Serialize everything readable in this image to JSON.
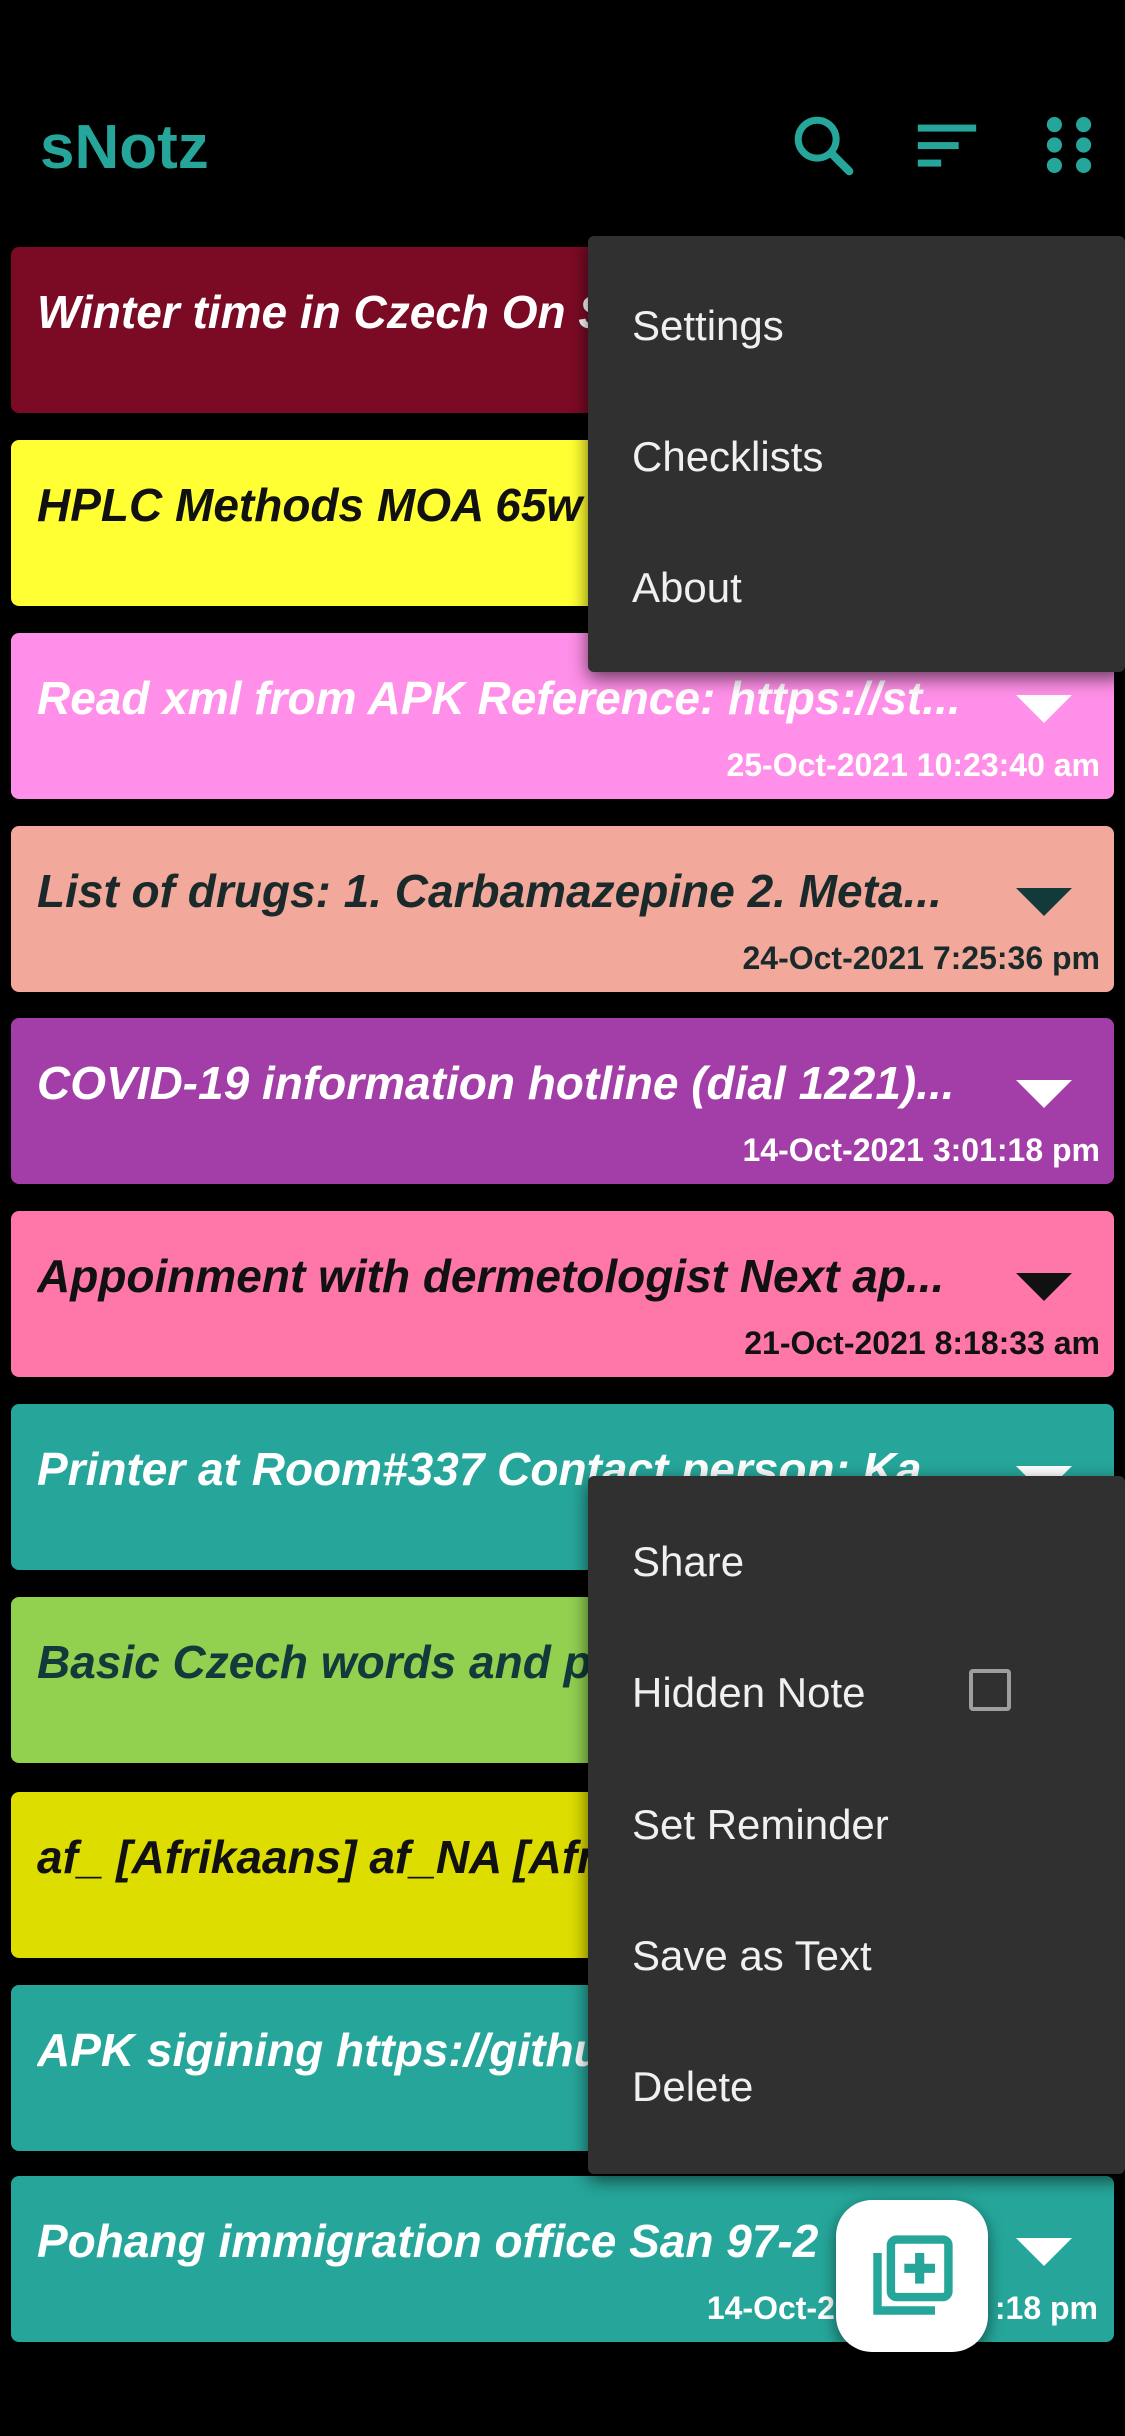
{
  "app": {
    "title": "sNotz",
    "accent_color": "#26a69a",
    "icons": [
      "search-icon",
      "sort-icon",
      "apps-grid-icon"
    ]
  },
  "notes": [
    {
      "title": "Winter time in Czech  On S",
      "date": "",
      "bg": "#7b0a25",
      "fg": "#ffffff",
      "caret": "#ffffff"
    },
    {
      "title": "HPLC Methods  MOA 65w",
      "date": "",
      "bg": "#ffff33",
      "fg": "#111111",
      "caret": "#111111"
    },
    {
      "title": "Read xml from APK Reference: https://st...",
      "date": "25-Oct-2021 10:23:40 am",
      "bg": "#ff8fe8",
      "fg": "#ffffff",
      "caret": "#ffffff"
    },
    {
      "title": "List of drugs: 1. Carbamazepine 2. Meta...",
      "date": "24-Oct-2021 7:25:36 pm",
      "bg": "#f2a89a",
      "fg": "#1a2a2a",
      "caret": "#123a3a"
    },
    {
      "title": "COVID-19 information hotline (dial 1221)...",
      "date": "14-Oct-2021 3:01:18 pm",
      "bg": "#a33ea8",
      "fg": "#ffffff",
      "caret": "#ffffff"
    },
    {
      "title": "Appoinment with dermetologist  Next ap...",
      "date": "21-Oct-2021 8:18:33 am",
      "bg": "#ff77a8",
      "fg": "#111111",
      "caret": "#111111"
    },
    {
      "title": "Printer at Room#337 Contact person: Ka",
      "date": "",
      "bg": "#26a69a",
      "fg": "#ffffff",
      "caret": "#ffffff"
    },
    {
      "title": "Basic Czech words and ph",
      "date": "",
      "bg": "#92d050",
      "fg": "#123a3a",
      "caret": "#123a3a"
    },
    {
      "title": "af_ [Afrikaans] af_NA [Afri",
      "date": "",
      "bg": "#dddd00",
      "fg": "#111111",
      "caret": "#111111"
    },
    {
      "title": "APK sigining https://githu",
      "date": "",
      "bg": "#26a69a",
      "fg": "#ffffff",
      "caret": "#ffffff"
    },
    {
      "title": "Pohang immigration office San 97-2",
      "date": "14-Oct-2",
      "date_tail": ":18 pm",
      "bg": "#26a69a",
      "fg": "#ffffff",
      "caret": "#ffffff"
    }
  ],
  "overflow_menu": {
    "items": [
      "Settings",
      "Checklists",
      "About"
    ]
  },
  "note_menu": {
    "items": [
      "Share",
      "Hidden Note",
      "Set Reminder",
      "Save as Text",
      "Delete"
    ],
    "hidden_note_checked": false
  },
  "fab": {
    "icon": "add-note-icon"
  }
}
